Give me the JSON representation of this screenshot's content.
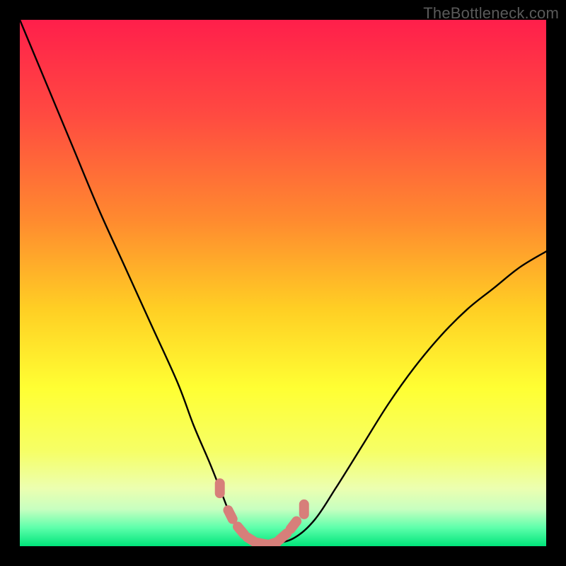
{
  "watermark": "TheBottleneck.com",
  "chart_data": {
    "type": "line",
    "title": "",
    "xlabel": "",
    "ylabel": "",
    "ylim": [
      0,
      100
    ],
    "xlim": [
      0,
      100
    ],
    "series": [
      {
        "name": "bottleneck-curve",
        "x": [
          0,
          5,
          10,
          15,
          20,
          25,
          30,
          33,
          36,
          38,
          40,
          42,
          44,
          46,
          48,
          52,
          56,
          60,
          65,
          70,
          75,
          80,
          85,
          90,
          95,
          100
        ],
        "y": [
          100,
          88,
          76,
          64,
          53,
          42,
          31,
          23,
          16,
          11,
          6,
          3,
          1.2,
          0.5,
          0.5,
          1.5,
          5,
          11,
          19,
          27,
          34,
          40,
          45,
          49,
          53,
          56
        ]
      }
    ],
    "markers": {
      "name": "highlighted-range",
      "color": "#d77f7a",
      "x": [
        38,
        40,
        42,
        44,
        46,
        48,
        50,
        52,
        54
      ],
      "y": [
        11,
        6,
        3,
        1.2,
        0.5,
        0.5,
        1.8,
        4,
        7
      ]
    },
    "gradient_stops": [
      {
        "offset": 0.0,
        "color": "#ff1f4b"
      },
      {
        "offset": 0.18,
        "color": "#ff4a41"
      },
      {
        "offset": 0.38,
        "color": "#ff8a2f"
      },
      {
        "offset": 0.55,
        "color": "#ffcf24"
      },
      {
        "offset": 0.7,
        "color": "#ffff33"
      },
      {
        "offset": 0.82,
        "color": "#f6ff66"
      },
      {
        "offset": 0.89,
        "color": "#ecffb0"
      },
      {
        "offset": 0.93,
        "color": "#c7ffc0"
      },
      {
        "offset": 0.965,
        "color": "#5dffab"
      },
      {
        "offset": 1.0,
        "color": "#00e57a"
      }
    ]
  }
}
